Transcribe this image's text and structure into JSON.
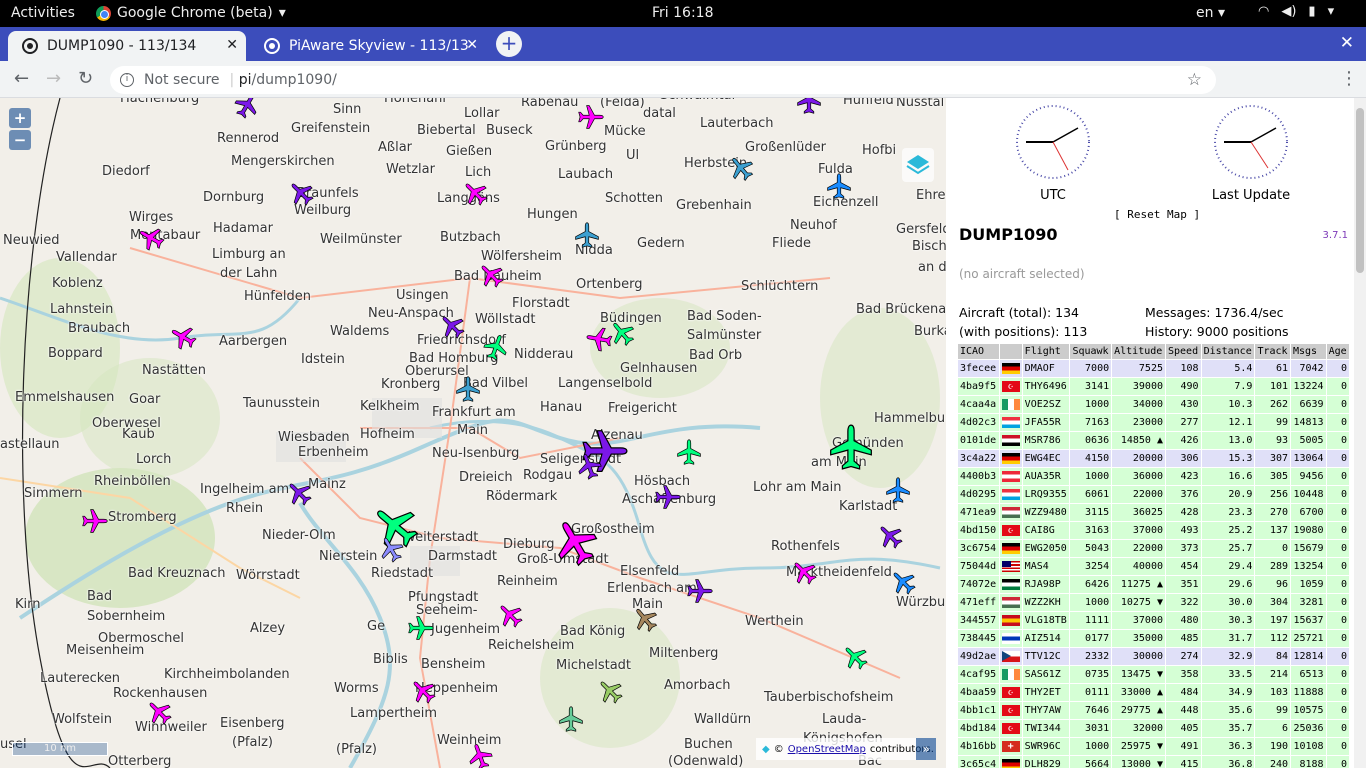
{
  "topbar": {
    "activities": "Activities",
    "app": "Google Chrome (beta)",
    "clock": "Fri 16:18",
    "lang": "en"
  },
  "tabs": [
    {
      "label": "DUMP1090 - 113/134",
      "active": true
    },
    {
      "label": "PiAware Skyview - 113/13",
      "active": false
    }
  ],
  "omnibox": {
    "security": "Not secure",
    "host": "pi",
    "path": "/dump1090/"
  },
  "map": {
    "places": [
      [
        "Hachenburg",
        120,
        99
      ],
      [
        "Rennerod",
        217,
        139
      ],
      [
        "Greifenstein",
        291,
        129
      ],
      [
        "Hohenahr",
        384,
        99
      ],
      [
        "Sinn",
        333,
        110
      ],
      [
        "Biebertal",
        417,
        131
      ],
      [
        "Buseck",
        486,
        131
      ],
      [
        "Lollar",
        464,
        114
      ],
      [
        "Rabenau",
        521,
        103
      ],
      [
        "(Felda)",
        600,
        103
      ],
      [
        "datal",
        643,
        114
      ],
      [
        "Schwalmtal",
        660,
        96
      ],
      [
        "Lauterbach",
        700,
        124
      ],
      [
        "Großenlüder",
        745,
        148
      ],
      [
        "Hunfeld",
        843,
        101
      ],
      [
        "Nüsstal",
        896,
        103
      ],
      [
        "Mengerskirchen",
        231,
        162
      ],
      [
        "Aßlar",
        378,
        148
      ],
      [
        "Gießen",
        446,
        152
      ],
      [
        "Grünberg",
        545,
        147
      ],
      [
        "Mücke",
        604,
        132
      ],
      [
        "Ul",
        626,
        156
      ],
      [
        "Herbstein",
        684,
        164
      ],
      [
        "Hofbi",
        862,
        151
      ],
      [
        "Diedorf",
        102,
        172
      ],
      [
        "Wetzlar",
        386,
        170
      ],
      [
        "Lich",
        465,
        173
      ],
      [
        "Laubach",
        558,
        175
      ],
      [
        "Fulda",
        818,
        170
      ],
      [
        "Dornburg",
        203,
        198
      ],
      [
        "Braunfels",
        297,
        194
      ],
      [
        "Weilburg",
        294,
        211
      ],
      [
        "Langgöns",
        437,
        199
      ],
      [
        "Schotten",
        605,
        199
      ],
      [
        "Grebenhain",
        676,
        206
      ],
      [
        "Eichenzell",
        813,
        203
      ],
      [
        "Ehre",
        916,
        196
      ],
      [
        "Wirges",
        129,
        218
      ],
      [
        "Montabaur",
        130,
        236
      ],
      [
        "Hadamar",
        213,
        229
      ],
      [
        "Hungen",
        527,
        215
      ],
      [
        "Neuhof",
        790,
        226
      ],
      [
        "Gersfeld",
        896,
        230
      ],
      [
        "Neuwied",
        3,
        241
      ],
      [
        "Limburg an",
        212,
        255
      ],
      [
        "Weilmünster",
        320,
        240
      ],
      [
        "Butzbach",
        440,
        238
      ],
      [
        "Gedern",
        637,
        244
      ],
      [
        "Fliede",
        772,
        244
      ],
      [
        "Bisch",
        912,
        247
      ],
      [
        "der Lahn",
        220,
        274
      ],
      [
        "Vallendar",
        56,
        258
      ],
      [
        "Wölfersheim",
        481,
        257
      ],
      [
        "Nidda",
        575,
        251
      ],
      [
        "an d",
        918,
        268
      ],
      [
        "Koblenz",
        52,
        284
      ],
      [
        "Bad Nauheim",
        454,
        277
      ],
      [
        "Ortenberg",
        576,
        285
      ],
      [
        "Schlüchtern",
        741,
        287
      ],
      [
        "Lahnstein",
        50,
        310
      ],
      [
        "Hünfelden",
        244,
        297
      ],
      [
        "Usingen",
        396,
        296
      ],
      [
        "Florstadt",
        512,
        304
      ],
      [
        "Bad Brückenau",
        856,
        310
      ],
      [
        "Braubach",
        68,
        329
      ],
      [
        "Neu-Anspach",
        368,
        314
      ],
      [
        "Wöllstadt",
        475,
        320
      ],
      [
        "Büdingen",
        600,
        319
      ],
      [
        "Bad Soden-",
        687,
        317
      ],
      [
        "Burka",
        914,
        332
      ],
      [
        "Aarbergen",
        219,
        342
      ],
      [
        "Waldems",
        330,
        332
      ],
      [
        "Friedrichsdorf",
        417,
        341
      ],
      [
        "Salmünster",
        687,
        336
      ],
      [
        "Boppard",
        48,
        354
      ],
      [
        "Idstein",
        301,
        360
      ],
      [
        "Bad Homburg",
        409,
        359
      ],
      [
        "Nidderau",
        514,
        355
      ],
      [
        "Bad Orb",
        689,
        356
      ],
      [
        "Nastätten",
        142,
        371
      ],
      [
        "Oberursel",
        405,
        372
      ],
      [
        "Gelnhausen",
        620,
        369
      ],
      [
        "Kronberg",
        381,
        385
      ],
      [
        "Bad Vilbel",
        463,
        384
      ],
      [
        "Langenselbold",
        558,
        384
      ],
      [
        "Emmelshausen",
        15,
        398
      ],
      [
        "Goar",
        129,
        400
      ],
      [
        "Taunusstein",
        243,
        404
      ],
      [
        "Kelkheim",
        360,
        407
      ],
      [
        "Frankfurt am",
        432,
        413
      ],
      [
        "Hanau",
        540,
        408
      ],
      [
        "Freigericht",
        608,
        409
      ],
      [
        "Hammelbu",
        874,
        419
      ],
      [
        "Oberwesel",
        92,
        424
      ],
      [
        "Kaub",
        122,
        435
      ],
      [
        "Wiesbaden",
        278,
        438
      ],
      [
        "Hofheim",
        360,
        435
      ],
      [
        "Main",
        457,
        431
      ],
      [
        "Alzenau",
        591,
        436
      ],
      [
        "Gemünden",
        832,
        444
      ],
      [
        "astellaun",
        0,
        445
      ],
      [
        "Erbenheim",
        298,
        453
      ],
      [
        "Neu-Isenburg",
        432,
        454
      ],
      [
        "Seligenstadt",
        540,
        460
      ],
      [
        "Lorch",
        136,
        460
      ],
      [
        "am Main",
        811,
        463
      ],
      [
        "Rodgau",
        523,
        476
      ],
      [
        "Hösbach",
        634,
        482
      ],
      [
        "Rheinböllen",
        94,
        482
      ],
      [
        "Dreieich",
        459,
        478
      ],
      [
        "Ingelheim am",
        200,
        490
      ],
      [
        "Mainz",
        308,
        485
      ],
      [
        "Lohr am Main",
        753,
        488
      ],
      [
        "Aschaffenburg",
        622,
        500
      ],
      [
        "Simmern",
        24,
        494
      ],
      [
        "Rödermark",
        486,
        497
      ],
      [
        "Rhein",
        226,
        509
      ],
      [
        "Karlstadt",
        839,
        507
      ],
      [
        "Stromberg",
        108,
        518
      ],
      [
        "Großostheim",
        571,
        530
      ],
      [
        "Weiterstadt",
        403,
        538
      ],
      [
        "Nieder-Olm",
        262,
        536
      ],
      [
        "Dieburg",
        503,
        545
      ],
      [
        "Rothenfels",
        771,
        547
      ],
      [
        "Darmstadt",
        428,
        557
      ],
      [
        "Groß-Umstadt",
        517,
        560
      ],
      [
        "Nierstein",
        319,
        557
      ],
      [
        "Elsenfeld",
        620,
        572
      ],
      [
        "Bad Kreuznach",
        128,
        574
      ],
      [
        "Wörrstadt",
        236,
        576
      ],
      [
        "Riedstadt",
        371,
        574
      ],
      [
        "Marktheidenfeld",
        786,
        573
      ],
      [
        "Reinheim",
        497,
        582
      ],
      [
        "Erlenbach am",
        607,
        589
      ],
      [
        "Würzbu",
        896,
        603
      ],
      [
        "Pfungstadt",
        408,
        598
      ],
      [
        "Main",
        632,
        605
      ],
      [
        "Bad",
        87,
        597
      ],
      [
        "Kirn",
        15,
        605
      ],
      [
        "Sobernheim",
        87,
        617
      ],
      [
        "Seeheim-",
        416,
        611
      ],
      [
        "Jugenheim",
        431,
        630
      ],
      [
        "Werthein",
        745,
        622
      ],
      [
        "Alzey",
        250,
        629
      ],
      [
        "Ge",
        367,
        627
      ],
      [
        "Bad König",
        560,
        632
      ],
      [
        "Obermoschel",
        98,
        639
      ],
      [
        "Meisenheim",
        66,
        651
      ],
      [
        "Reichelsheim",
        488,
        646
      ],
      [
        "Miltenberg",
        649,
        654
      ],
      [
        "Biblis",
        373,
        660
      ],
      [
        "Bensheim",
        421,
        665
      ],
      [
        "Michelstadt",
        556,
        666
      ],
      [
        "Lauterecken",
        40,
        679
      ],
      [
        "Kirchheimbolanden",
        164,
        675
      ],
      [
        "Amorbach",
        664,
        686
      ],
      [
        "Worms",
        334,
        689
      ],
      [
        "Heppenheim",
        415,
        689
      ],
      [
        "Tauberbischofsheim",
        764,
        698
      ],
      [
        "Rockenhausen",
        113,
        694
      ],
      [
        "Lampertheim",
        350,
        714
      ],
      [
        "Lauda-",
        822,
        720
      ],
      [
        "Wolfstein",
        52,
        720
      ],
      [
        "Winnweiler",
        135,
        728
      ],
      [
        "Eisenberg",
        220,
        724
      ],
      [
        "Walldürn",
        694,
        720
      ],
      [
        "(Pfalz)",
        232,
        743
      ],
      [
        "(Pfalz)",
        336,
        750
      ],
      [
        "Weinheim",
        437,
        741
      ],
      [
        "Buchen",
        684,
        745
      ],
      [
        "Königshofen",
        803,
        739
      ],
      [
        "usel",
        0,
        745
      ],
      [
        "Otterberg",
        108,
        762
      ],
      [
        "(Odenwald)",
        668,
        762
      ],
      [
        "Bac",
        858,
        762
      ]
    ],
    "scale": "10 nm",
    "attribution_prefix": "©",
    "attribution_link": "OpenStreetMap",
    "attribution_suffix": "contributors.",
    "zoom_in": "+",
    "zoom_out": "−",
    "collapse": "»"
  },
  "sidebar": {
    "clock_utc": "UTC",
    "clock_last": "Last Update",
    "reset": "[ Reset Map ]",
    "title": "DUMP1090",
    "version": "3.7.1",
    "no_selection": "(no aircraft selected)",
    "aircraft_total": "Aircraft (total): 134",
    "with_positions": "(with positions): 113",
    "messages": "Messages: 1736.4/sec",
    "history": "History: 9000 positions",
    "columns": [
      "ICAO",
      "",
      "Flight",
      "Squawk",
      "Altitude",
      "Speed",
      "Distance",
      "Track",
      "Msgs",
      "Age"
    ],
    "rows": [
      [
        "3fecee",
        "de",
        "DMAOF",
        "7000",
        "7525",
        "108",
        "5.4",
        "61",
        "7042",
        "0",
        "p"
      ],
      [
        "4ba9f5",
        "tr",
        "THY6496",
        "3141",
        "39000",
        "490",
        "7.9",
        "101",
        "13224",
        "0",
        "g"
      ],
      [
        "4caa4a",
        "ie",
        "VOE2SZ",
        "1000",
        "34000",
        "430",
        "10.3",
        "262",
        "6639",
        "0",
        "g"
      ],
      [
        "4d02c3",
        "lu",
        "JFA55R",
        "7163",
        "23000",
        "277",
        "12.1",
        "99",
        "14813",
        "0",
        "g"
      ],
      [
        "0101de",
        "eg",
        "MSR786",
        "0636",
        "14850 ▲",
        "426",
        "13.0",
        "93",
        "5005",
        "0",
        "g"
      ],
      [
        "3c4a22",
        "de",
        "EWG4EC",
        "4150",
        "20000",
        "306",
        "15.3",
        "307",
        "13064",
        "0",
        "p"
      ],
      [
        "4400b3",
        "at",
        "AUA35R",
        "1000",
        "36000",
        "423",
        "16.6",
        "305",
        "9456",
        "0",
        "g"
      ],
      [
        "4d0295",
        "lu",
        "LRQ9355",
        "6061",
        "22000",
        "376",
        "20.9",
        "256",
        "10448",
        "0",
        "g"
      ],
      [
        "471ea9",
        "hu",
        "WZZ9480",
        "3115",
        "36025",
        "428",
        "23.3",
        "270",
        "6700",
        "0",
        "g"
      ],
      [
        "4bd150",
        "tr",
        "CAI8G",
        "3163",
        "37000",
        "493",
        "25.2",
        "137",
        "19080",
        "0",
        "g"
      ],
      [
        "3c6754",
        "de",
        "EWG2050",
        "5043",
        "22000",
        "373",
        "25.7",
        "0",
        "15679",
        "0",
        "g"
      ],
      [
        "75044d",
        "my",
        "MAS4",
        "3254",
        "40000",
        "454",
        "29.4",
        "289",
        "13254",
        "0",
        "g"
      ],
      [
        "74072e",
        "jo",
        "RJA98P",
        "6426",
        "11275 ▲",
        "351",
        "29.6",
        "96",
        "1059",
        "0",
        "g"
      ],
      [
        "471eff",
        "hu",
        "WZZ2KH",
        "1000",
        "10275 ▼",
        "322",
        "30.0",
        "304",
        "3281",
        "0",
        "g"
      ],
      [
        "344557",
        "es",
        "VLG18TB",
        "1111",
        "37000",
        "480",
        "30.3",
        "197",
        "15637",
        "0",
        "g"
      ],
      [
        "738445",
        "il",
        "AIZ514",
        "0177",
        "35000",
        "485",
        "31.7",
        "112",
        "25721",
        "0",
        "g"
      ],
      [
        "49d2ae",
        "cz",
        "TTV12C",
        "2332",
        "30000",
        "274",
        "32.9",
        "84",
        "12814",
        "0",
        "p"
      ],
      [
        "4caf95",
        "ie",
        "SAS61Z",
        "0735",
        "13475 ▼",
        "358",
        "33.5",
        "214",
        "6513",
        "0",
        "g"
      ],
      [
        "4baa59",
        "tr",
        "THY2ET",
        "0111",
        "33000 ▲",
        "484",
        "34.9",
        "103",
        "11888",
        "0",
        "g"
      ],
      [
        "4bb1c1",
        "tr",
        "THY7AW",
        "7646",
        "29775 ▲",
        "448",
        "35.6",
        "99",
        "10575",
        "0",
        "g"
      ],
      [
        "4bd184",
        "tr",
        "TWI344",
        "3031",
        "32000",
        "405",
        "35.7",
        "6",
        "25036",
        "0",
        "g"
      ],
      [
        "4b16bb",
        "ch",
        "SWR96C",
        "1000",
        "25975 ▼",
        "491",
        "36.3",
        "190",
        "10108",
        "0",
        "g"
      ],
      [
        "3c65c4",
        "de",
        "DLH829",
        "5664",
        "13000 ▼",
        "415",
        "36.8",
        "240",
        "8188",
        "0",
        "g"
      ]
    ]
  },
  "planes": [
    [
      "#7b17e8",
      247,
      105,
      30
    ],
    [
      "#7b17e8",
      809,
      101,
      0
    ],
    [
      "#ff00ff",
      591,
      117,
      90
    ],
    [
      "#3da0d0",
      741,
      168,
      -40
    ],
    [
      "#7b17e8",
      301,
      193,
      -45
    ],
    [
      "#1a8cff",
      839,
      186,
      0
    ],
    [
      "#ff00ff",
      475,
      193,
      -45
    ],
    [
      "#ff00ff",
      151,
      238,
      -60
    ],
    [
      "#3da0d0",
      587,
      235,
      0
    ],
    [
      "#ff00ff",
      491,
      275,
      -45
    ],
    [
      "#ff00ff",
      183,
      337,
      -60
    ],
    [
      "#7b17e8",
      452,
      326,
      -45
    ],
    [
      "#00ff7f",
      496,
      347,
      20
    ],
    [
      "#ff00ff",
      599,
      339,
      -80
    ],
    [
      "#00ff7f",
      622,
      333,
      -40
    ],
    [
      "#3da0d0",
      468,
      389,
      0
    ],
    [
      "#7b17e8",
      605,
      451,
      90
    ],
    [
      "#00ff7f",
      689,
      452,
      0
    ],
    [
      "#7b17e8",
      589,
      466,
      -20
    ],
    [
      "#00ff7f",
      851,
      447,
      0
    ],
    [
      "#7b17e8",
      668,
      497,
      90
    ],
    [
      "#1a8cff",
      898,
      490,
      0
    ],
    [
      "#7b17e8",
      299,
      493,
      -45
    ],
    [
      "#ff00ff",
      95,
      521,
      90
    ],
    [
      "#00ff7f",
      395,
      526,
      -50
    ],
    [
      "#8c8cff",
      391,
      549,
      -30
    ],
    [
      "#ff00ff",
      575,
      542,
      -30
    ],
    [
      "#7b17e8",
      890,
      536,
      -45
    ],
    [
      "#ff00ff",
      804,
      572,
      -45
    ],
    [
      "#1a8cff",
      903,
      582,
      -45
    ],
    [
      "#7b17e8",
      700,
      591,
      90
    ],
    [
      "#ff00ff",
      510,
      615,
      -45
    ],
    [
      "#a6875e",
      645,
      619,
      -40
    ],
    [
      "#00ff7f",
      421,
      628,
      90
    ],
    [
      "#00ff7f",
      855,
      657,
      -45
    ],
    [
      "#ff00ff",
      423,
      691,
      -45
    ],
    [
      "#99cc66",
      610,
      691,
      -45
    ],
    [
      "#ff00ff",
      159,
      712,
      -45
    ],
    [
      "#66cc99",
      571,
      719,
      0
    ],
    [
      "#ff00ff",
      480,
      756,
      -20
    ]
  ]
}
